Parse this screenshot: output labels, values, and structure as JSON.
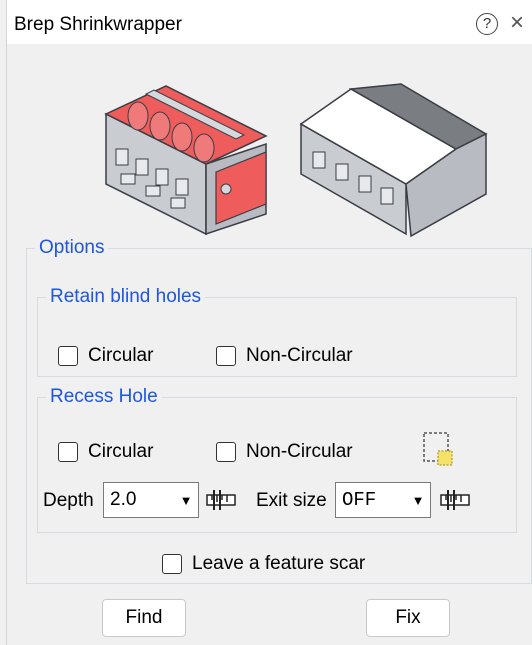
{
  "window": {
    "title": "Brep Shrinkwrapper"
  },
  "options": {
    "legend": "Options",
    "retain_blind_holes": {
      "legend": "Retain blind holes",
      "circular_label": "Circular",
      "non_circular_label": "Non-Circular"
    },
    "recess_hole": {
      "legend": "Recess Hole",
      "circular_label": "Circular",
      "non_circular_label": "Non-Circular",
      "depth_label": "Depth",
      "depth_value": "2.0",
      "exit_size_label": "Exit size",
      "exit_size_value": "OFF"
    },
    "feature_scar_label": "Leave a feature scar"
  },
  "buttons": {
    "find": "Find",
    "fix": "Fix"
  },
  "colors": {
    "accent": "#1f55e0",
    "highlight": "#ee5c5c"
  }
}
